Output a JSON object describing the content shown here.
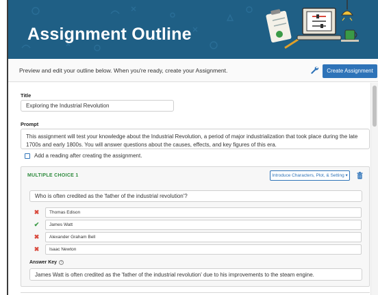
{
  "header": {
    "title": "Assignment Outline"
  },
  "toolbar": {
    "hint": "Preview and edit your outline below. When you're ready, create your Assignment.",
    "create_label": "Create Assignment"
  },
  "form": {
    "title_label": "Title",
    "title_value": "Exploring the Industrial Revolution",
    "prompt_label": "Prompt",
    "prompt_value": "This assignment will test your knowledge about the Industrial Revolution, a period of major industrialization that took place during the late 1700s and early 1800s. You will answer questions about the causes, effects, and key figures of this era.",
    "add_reading_label": "Add a reading after creating the assignment.",
    "add_reading_checked": false
  },
  "question": {
    "heading": "MULTIPLE CHOICE 1",
    "standard_label": "Introduce Characters, Plot, & Setting ▾",
    "text": "Who is often credited as the 'father of the industrial revolution'?",
    "answers": [
      {
        "text": "Thomas Edison",
        "correct": false
      },
      {
        "text": "James Watt",
        "correct": true
      },
      {
        "text": "Alexander Graham Bell",
        "correct": false
      },
      {
        "text": "Isaac Newton",
        "correct": false
      }
    ],
    "answer_key_label": "Answer Key",
    "answer_key_info": "?",
    "answer_key_value": "James Watt is often credited as the 'father of the industrial revolution' due to his improvements to the steam engine."
  },
  "icons": {
    "wrench": "wrench-icon",
    "trash": "trash-icon",
    "correct": "check-icon",
    "wrong": "x-icon"
  },
  "marks": {
    "right": "✔",
    "wrong": "✖"
  },
  "colors": {
    "banner": "#1f5f85",
    "primary": "#2e73b8",
    "correct": "#3a9a46",
    "wrong": "#d94a3d",
    "question_heading": "#2e8b3d"
  }
}
